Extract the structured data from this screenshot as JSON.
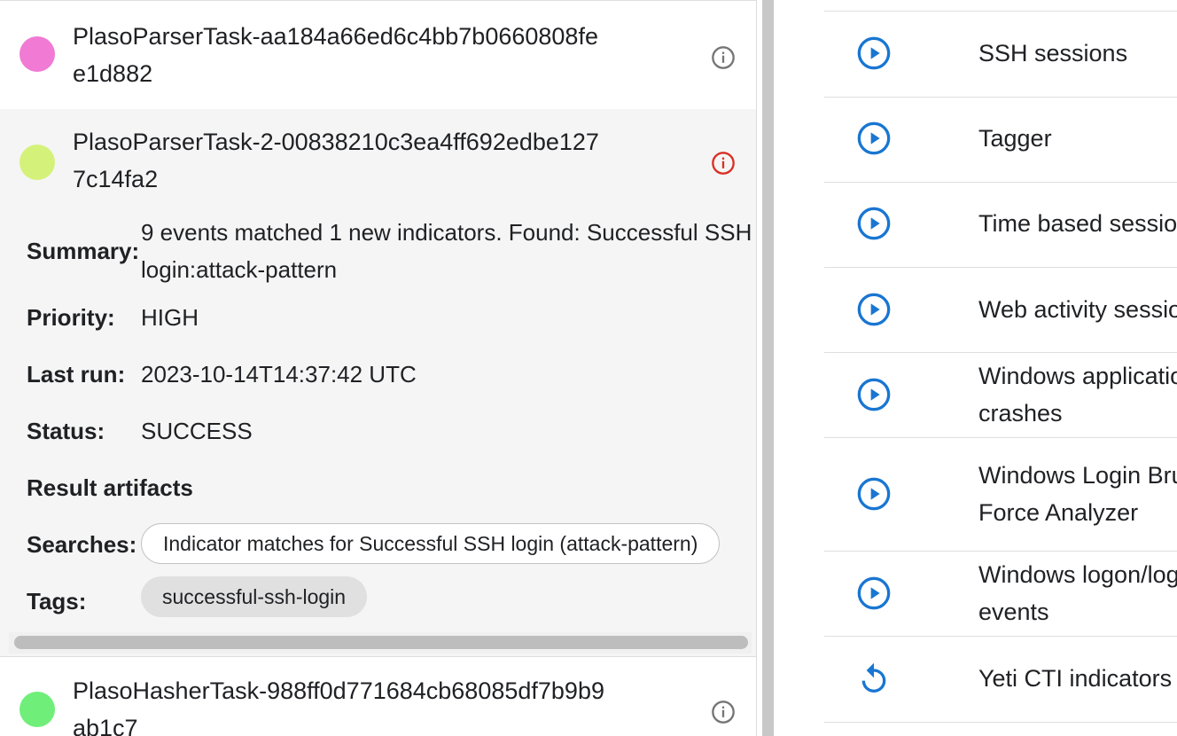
{
  "tasks": [
    {
      "name": "PlasoParserTask-aa184a66ed6c4bb7b0660808fee1d882",
      "dot_color": "#f07ad4",
      "icon": "info-icon",
      "icon_color": "#757575"
    },
    {
      "name": "PlasoParserTask-2-00838210c3ea4ff692edbe1277c14fa2",
      "dot_color": "#d4f27a",
      "icon": "info-icon",
      "icon_color": "#d93025",
      "details": {
        "summary_label": "Summary:",
        "summary_value": "9 events matched 1 new indicators. Found: Successful SSH login:attack-pattern",
        "priority_label": "Priority:",
        "priority_value": "HIGH",
        "last_run_label": "Last run:",
        "last_run_value": "2023-10-14T14:37:42 UTC",
        "status_label": "Status:",
        "status_value": "SUCCESS",
        "result_artifacts_label": "Result artifacts",
        "searches_label": "Searches:",
        "searches_value": "Indicator matches for Successful SSH login (attack-pattern)",
        "tags_label": "Tags:",
        "tags_value": "successful-ssh-login"
      }
    },
    {
      "name": "PlasoHasherTask-988ff0d771684cb68085df7b9b9ab1c7",
      "dot_color": "#6fef7a",
      "icon": "info-icon",
      "icon_color": "#757575"
    }
  ],
  "analyzers": [
    {
      "label": "SSH sessions",
      "icon": "play-circle-icon"
    },
    {
      "label": "Tagger",
      "icon": "play-circle-icon"
    },
    {
      "label": "Time based sessions",
      "icon": "play-circle-icon"
    },
    {
      "label": "Web activity sessions",
      "icon": "play-circle-icon"
    },
    {
      "label": "Windows application crashes",
      "icon": "play-circle-icon"
    },
    {
      "label": "Windows Login Brute Force Analyzer",
      "icon": "play-circle-icon"
    },
    {
      "label": "Windows logon/logoff events",
      "icon": "play-circle-icon"
    },
    {
      "label": "Yeti CTI indicators",
      "icon": "rerun-icon"
    }
  ],
  "colors": {
    "accent_blue": "#1976d2",
    "error_red": "#d93025"
  }
}
